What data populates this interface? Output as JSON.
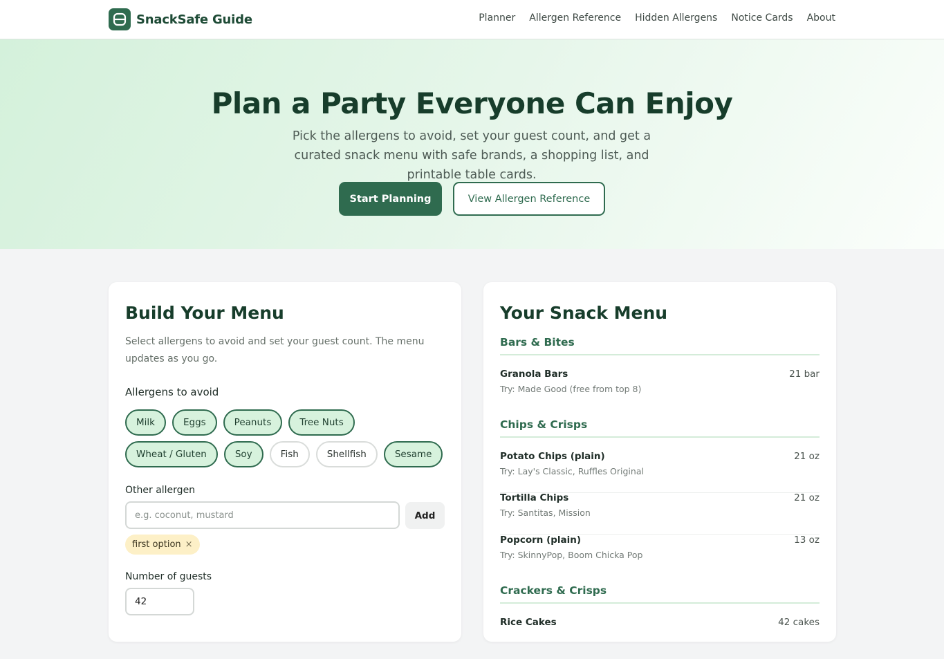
{
  "header": {
    "brand": "SnackSafe Guide",
    "nav": [
      "Planner",
      "Allergen Reference",
      "Hidden Allergens",
      "Notice Cards",
      "About"
    ]
  },
  "hero": {
    "title": "Plan a Party Everyone Can Enjoy",
    "subtitle": "Pick the allergens to avoid, set your guest count, and get a curated snack menu with safe brands, a shopping list, and printable table cards.",
    "primary_button": "Start Planning",
    "secondary_button": "View Allergen Reference"
  },
  "builder": {
    "title": "Build Your Menu",
    "description": "Select allergens to avoid and set your guest count. The menu updates as you go.",
    "allergens_label": "Allergens to avoid",
    "allergens": [
      {
        "label": "Milk",
        "selected": true
      },
      {
        "label": "Eggs",
        "selected": true
      },
      {
        "label": "Peanuts",
        "selected": true
      },
      {
        "label": "Tree Nuts",
        "selected": true
      },
      {
        "label": "Wheat / Gluten",
        "selected": true
      },
      {
        "label": "Soy",
        "selected": true
      },
      {
        "label": "Fish",
        "selected": false
      },
      {
        "label": "Shellfish",
        "selected": false
      },
      {
        "label": "Sesame",
        "selected": true
      }
    ],
    "other_label": "Other allergen",
    "other_placeholder": "e.g. coconut, mustard",
    "add_button": "Add",
    "custom_tags": [
      {
        "label": "first option",
        "remove": "×"
      }
    ],
    "guests_label": "Number of guests",
    "guests_value": "42"
  },
  "menu": {
    "title": "Your Snack Menu",
    "sections": [
      {
        "title": "Bars & Bites",
        "items": [
          {
            "name": "Granola Bars",
            "qty": "21 bar",
            "try": "Try: Made Good (free from top 8)"
          }
        ]
      },
      {
        "title": "Chips & Crisps",
        "items": [
          {
            "name": "Potato Chips (plain)",
            "qty": "21 oz",
            "try": "Try: Lay's Classic, Ruffles Original"
          },
          {
            "name": "Tortilla Chips",
            "qty": "21 oz",
            "try": "Try: Santitas, Mission"
          },
          {
            "name": "Popcorn (plain)",
            "qty": "13 oz",
            "try": "Try: SkinnyPop, Boom Chicka Pop"
          }
        ]
      },
      {
        "title": "Crackers & Crisps",
        "items": [
          {
            "name": "Rice Cakes",
            "qty": "42 cakes",
            "try": ""
          }
        ]
      }
    ]
  },
  "colors": {
    "brand": "#2f6b4f",
    "heading": "#173d2b",
    "chip_selected_bg": "#d7f2dd",
    "tag_bg": "#fdf0c7"
  }
}
